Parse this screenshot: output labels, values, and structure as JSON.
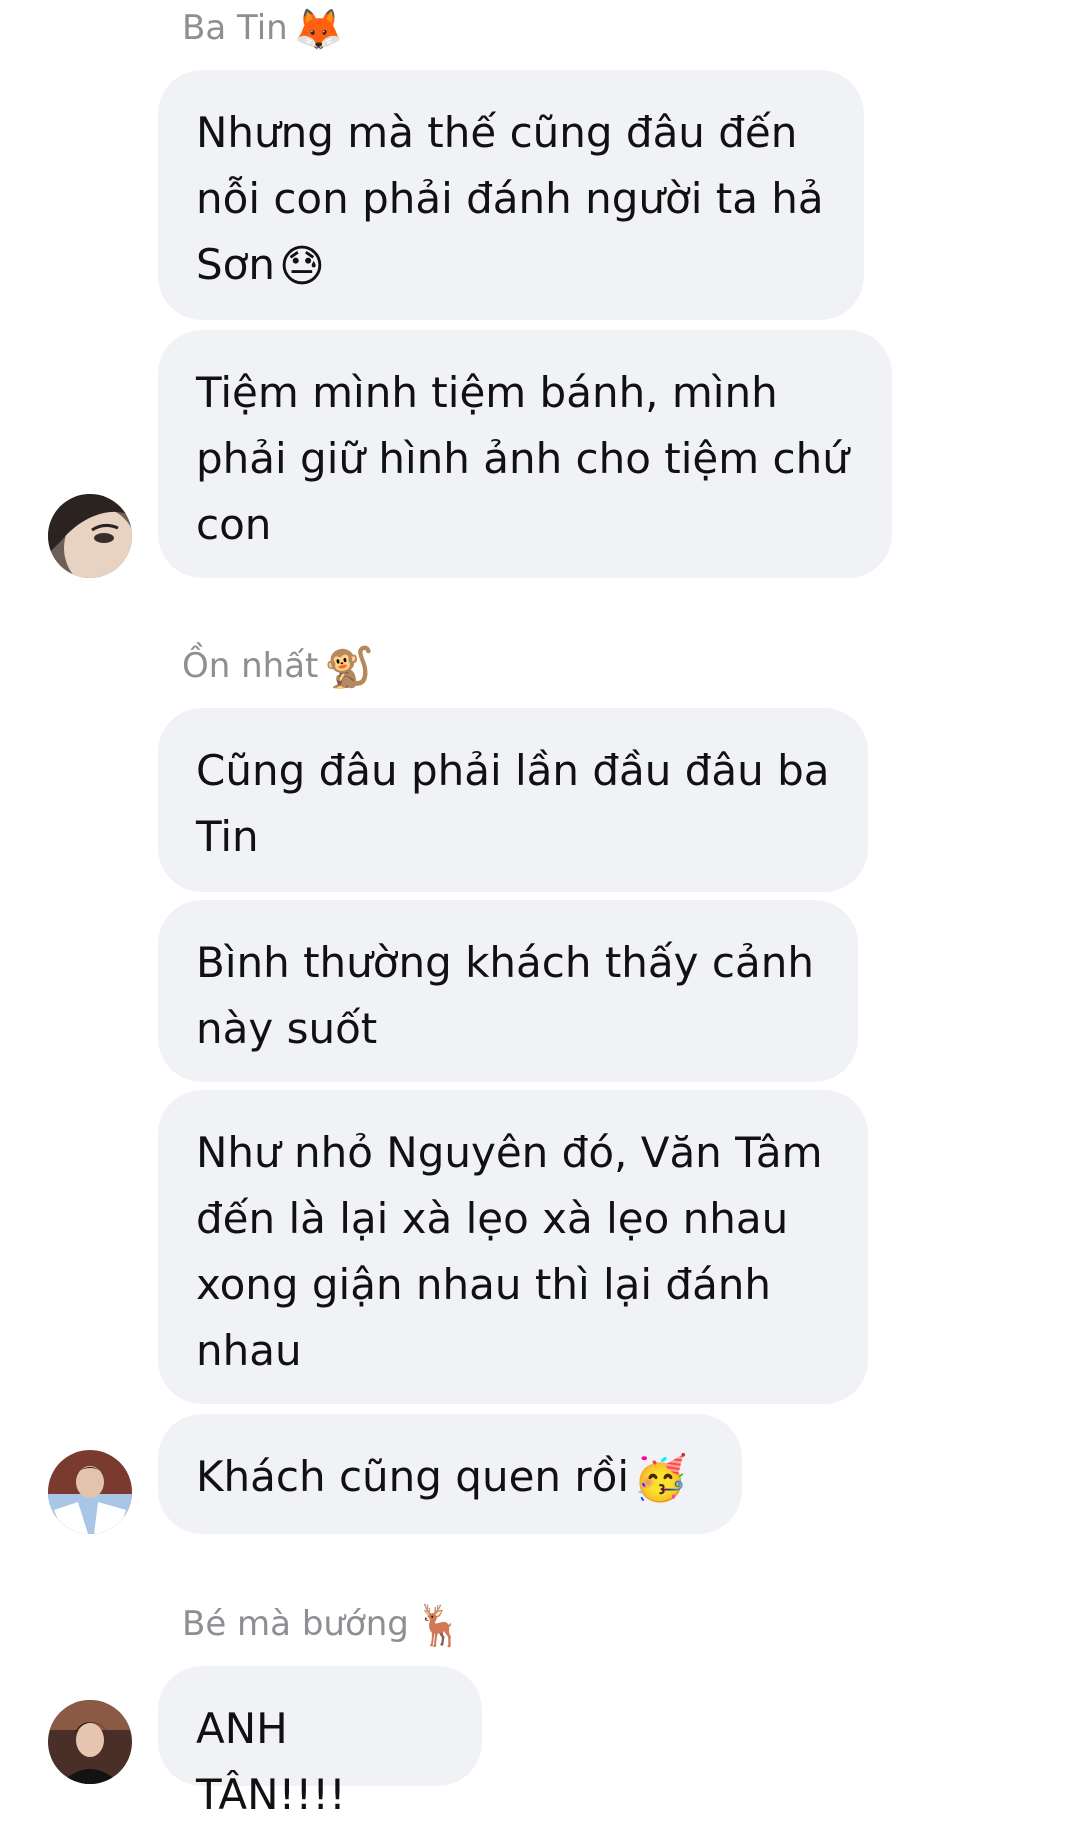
{
  "thread": {
    "groups": [
      {
        "sender": {
          "name": "Ba Tin",
          "emoji": "🦊"
        },
        "messages": [
          {
            "text": "Nhưng mà thế cũng đâu đến nỗi con phải đánh người ta hả Sơn",
            "emoji": "😓"
          },
          {
            "text": "Tiệm mình tiệm bánh, mình phải giữ hình ảnh cho tiệm chứ con"
          }
        ]
      },
      {
        "sender": {
          "name": "Ồn nhất",
          "emoji": "🐒"
        },
        "messages": [
          {
            "text": "Cũng đâu phải lần đầu đâu ba Tin"
          },
          {
            "text": "Bình thường khách thấy cảnh này suốt"
          },
          {
            "text": "Như nhỏ Nguyên đó, Văn Tâm đến là lại xà lẹo xà lẹo nhau xong giận nhau thì lại đánh nhau"
          },
          {
            "text": "Khách cũng quen rồi",
            "emoji": "🥳"
          }
        ]
      },
      {
        "sender": {
          "name": "Bé mà bướng",
          "emoji": "🦌"
        },
        "messages": [
          {
            "text": "ANH TÂN!!!!"
          }
        ]
      }
    ]
  },
  "colors": {
    "bubble_background": "#f1f2f5",
    "sender_name": "#8e8e93",
    "message_text": "#111111"
  }
}
